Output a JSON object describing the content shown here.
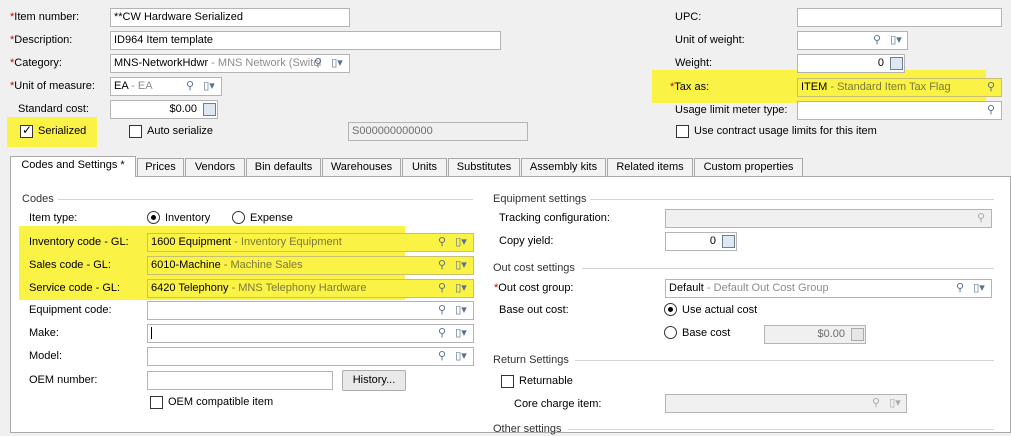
{
  "header": {
    "item_number": {
      "label": "Item number:",
      "value": "**CW Hardware Serialized"
    },
    "description": {
      "label": "Description:",
      "value": "ID964 Item template"
    },
    "category": {
      "label": "Category:",
      "code": "MNS-NetworkHdwr",
      "desc": "- MNS Network (Switcl"
    },
    "unit_of_measure": {
      "label": "Unit of measure:",
      "code": "EA",
      "desc": "- EA"
    },
    "standard_cost": {
      "label": "Standard cost:",
      "value": "$0.00"
    },
    "serialized": {
      "label": "Serialized",
      "checked": true
    },
    "auto_serialize": {
      "label": "Auto serialize",
      "checked": false
    },
    "serial_mask": "S000000000000",
    "upc": {
      "label": "UPC:",
      "value": ""
    },
    "unit_of_weight": {
      "label": "Unit of weight:",
      "value": ""
    },
    "weight": {
      "label": "Weight:",
      "value": "0"
    },
    "tax_as": {
      "label": "Tax as:",
      "code": "ITEM",
      "desc": "- Standard Item Tax Flag"
    },
    "usage_limit_meter_type": {
      "label": "Usage limit meter type:",
      "value": ""
    },
    "use_contract_usage": {
      "label": "Use contract usage limits for this item",
      "checked": false
    }
  },
  "tabs": [
    {
      "label": "Codes and Settings *",
      "active": true
    },
    {
      "label": "Prices"
    },
    {
      "label": "Vendors"
    },
    {
      "label": "Bin defaults"
    },
    {
      "label": "Warehouses"
    },
    {
      "label": "Units"
    },
    {
      "label": "Substitutes"
    },
    {
      "label": "Assembly kits"
    },
    {
      "label": "Related items"
    },
    {
      "label": "Custom properties"
    }
  ],
  "codes": {
    "group_title": "Codes",
    "item_type": {
      "label": "Item type:",
      "options": [
        "Inventory",
        "Expense"
      ],
      "selected": "Inventory"
    },
    "inventory_code": {
      "label": "Inventory code - GL:",
      "code": "1600 Equipment",
      "desc": "- Inventory Equipment"
    },
    "sales_code": {
      "label": "Sales code - GL:",
      "code": "6010-Machine",
      "desc": "- Machine Sales"
    },
    "service_code": {
      "label": "Service code - GL:",
      "code": "6420 Telephony",
      "desc": "- MNS Telephony Hardware"
    },
    "equipment_code": {
      "label": "Equipment code:",
      "value": ""
    },
    "make": {
      "label": "Make:",
      "value": ""
    },
    "model": {
      "label": "Model:",
      "value": ""
    },
    "oem_number": {
      "label": "OEM number:",
      "value": ""
    },
    "history_button": "History...",
    "oem_compatible": {
      "label": "OEM compatible item",
      "checked": false
    }
  },
  "equipment_settings": {
    "group_title": "Equipment settings",
    "tracking_configuration": {
      "label": "Tracking configuration:",
      "value": ""
    },
    "copy_yield": {
      "label": "Copy yield:",
      "value": "0"
    }
  },
  "out_cost_settings": {
    "group_title": "Out cost settings",
    "out_cost_group": {
      "label": "Out cost group:",
      "code": "Default",
      "desc": "- Default Out Cost Group"
    },
    "base_out_cost": {
      "label": "Base out cost:",
      "options": [
        "Use actual cost",
        "Base cost"
      ],
      "selected": "Use actual cost",
      "base_cost_value": "$0.00"
    }
  },
  "return_settings": {
    "group_title": "Return Settings",
    "returnable": {
      "label": "Returnable",
      "checked": false
    },
    "core_charge_item": {
      "label": "Core charge item:",
      "value": ""
    }
  },
  "other_settings": {
    "group_title": "Other settings"
  },
  "colors": {
    "highlight": "#fbf246",
    "required": "#d40000"
  },
  "icons": {
    "lookup": "magnifier-icon",
    "dropdown": "document-dropdown-icon",
    "calculator": "calculator-icon"
  }
}
